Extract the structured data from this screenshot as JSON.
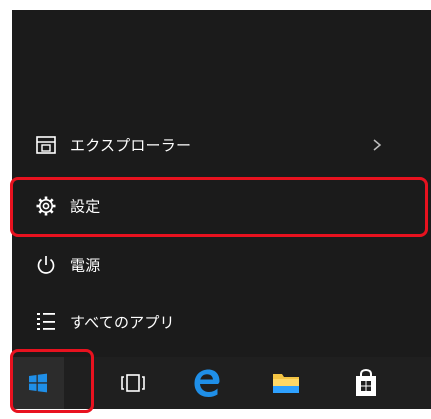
{
  "start_menu": {
    "items": [
      {
        "label": "エクスプローラー",
        "icon": "file-explorer-icon",
        "has_submenu": true
      },
      {
        "label": "設定",
        "icon": "settings-gear-icon",
        "highlighted": true
      },
      {
        "label": "電源",
        "icon": "power-icon"
      },
      {
        "label": "すべてのアプリ",
        "icon": "all-apps-list-icon"
      }
    ]
  },
  "taskbar": {
    "buttons": [
      {
        "name": "start-button",
        "icon": "windows-logo-icon",
        "highlighted": true
      },
      {
        "name": "task-view-button",
        "icon": "task-view-icon"
      },
      {
        "name": "edge-button",
        "icon": "edge-browser-icon"
      },
      {
        "name": "file-explorer-button",
        "icon": "folder-icon"
      },
      {
        "name": "store-button",
        "icon": "store-bag-icon"
      }
    ]
  },
  "colors": {
    "menu_background": "#1b1b1b",
    "taskbar_background": "#1f1f1f",
    "highlight_border": "#e8121f",
    "accent_blue": "#1f8fe8",
    "text": "#ffffff"
  }
}
